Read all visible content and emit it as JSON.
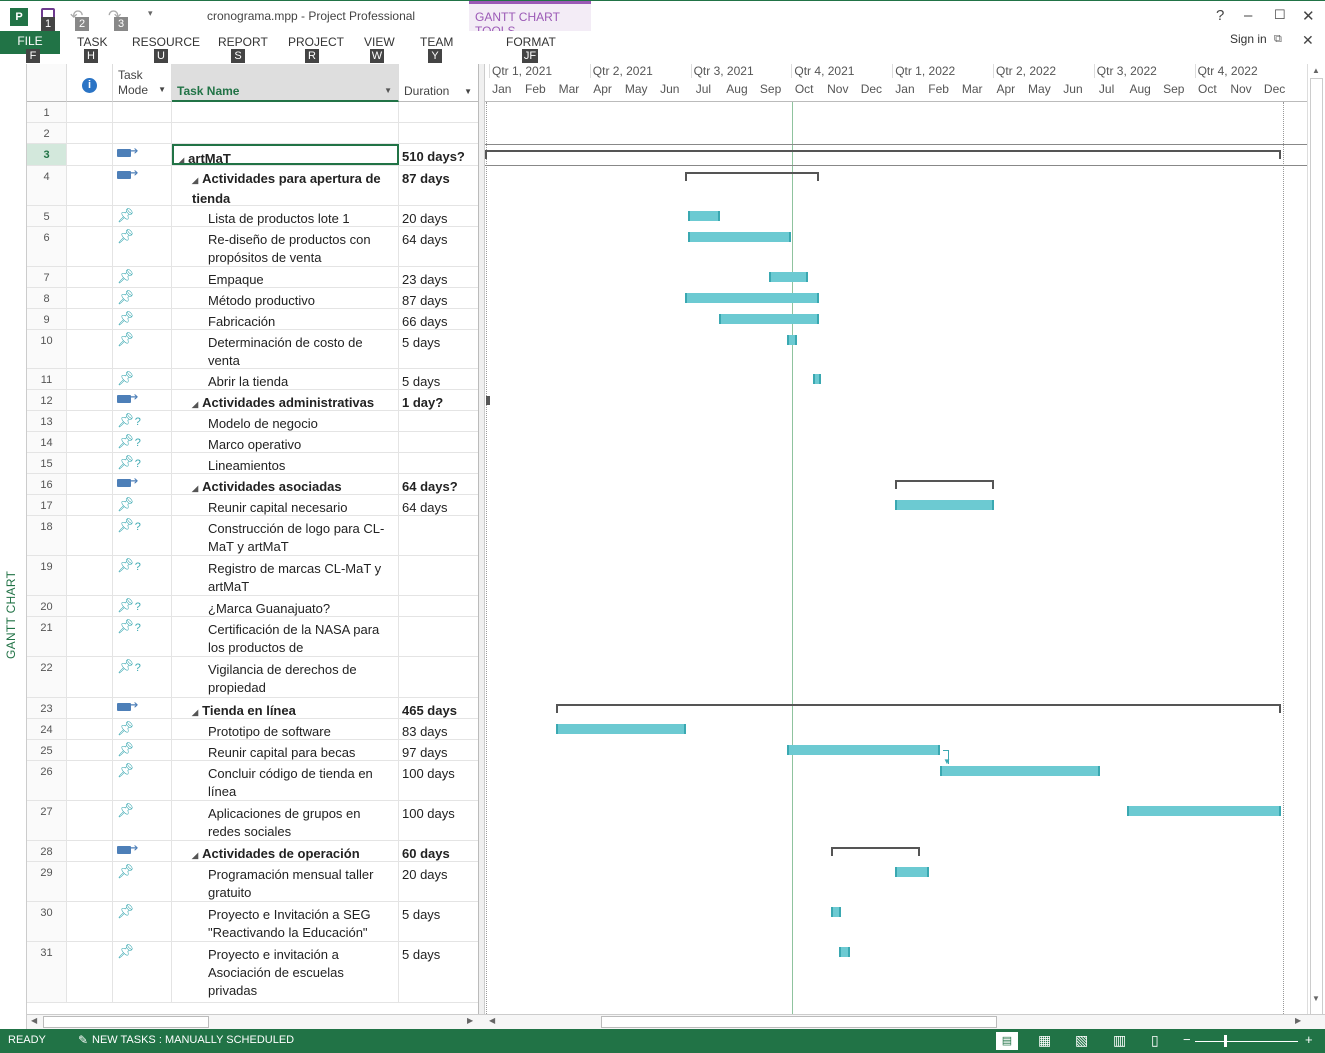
{
  "window": {
    "title": "cronograma.mpp - Project Professional",
    "context_tab": "GANTT CHART TOOLS",
    "help": "?",
    "signin": "Sign in"
  },
  "qat": {
    "key1": "1",
    "key2": "2",
    "key3": "3"
  },
  "ribbon": {
    "tabs": [
      {
        "label": "FILE",
        "key": "F"
      },
      {
        "label": "TASK",
        "key": "H"
      },
      {
        "label": "RESOURCE",
        "key": "U"
      },
      {
        "label": "REPORT",
        "key": "S"
      },
      {
        "label": "PROJECT",
        "key": "R"
      },
      {
        "label": "VIEW",
        "key": "W"
      },
      {
        "label": "TEAM",
        "key": "Y"
      },
      {
        "label": "FORMAT",
        "key": "JF"
      }
    ]
  },
  "view_label": "GANTT CHART",
  "grid_headers": {
    "mode": "Task Mode",
    "name": "Task Name",
    "duration": "Duration"
  },
  "timescale": {
    "quarters": [
      "Qtr 1, 2021",
      "Qtr 2, 2021",
      "Qtr 3, 2021",
      "Qtr 4, 2021",
      "Qtr 1, 2022",
      "Qtr 2, 2022",
      "Qtr 3, 2022",
      "Qtr 4, 2022"
    ],
    "months": [
      "Jan",
      "Feb",
      "Mar",
      "Apr",
      "May",
      "Jun",
      "Jul",
      "Aug",
      "Sep",
      "Oct",
      "Nov",
      "Dec",
      "Jan",
      "Feb",
      "Mar",
      "Apr",
      "May",
      "Jun",
      "Jul",
      "Aug",
      "Sep",
      "Oct",
      "Nov",
      "Dec"
    ]
  },
  "tasks": [
    {
      "id": "1",
      "name": "",
      "duration": "",
      "mode": "",
      "level": 0,
      "summary": false
    },
    {
      "id": "2",
      "name": "",
      "duration": "",
      "mode": "",
      "level": 0,
      "summary": false
    },
    {
      "id": "3",
      "name": "artMaT",
      "duration": "510 days?",
      "mode": "auto",
      "level": 0,
      "summary": true
    },
    {
      "id": "4",
      "name": "Actividades para apertura de tienda",
      "duration": "87 days",
      "mode": "auto",
      "level": 1,
      "summary": true
    },
    {
      "id": "5",
      "name": "Lista de productos lote 1",
      "duration": "20 days",
      "mode": "manual",
      "level": 2,
      "summary": false
    },
    {
      "id": "6",
      "name": "Re-diseño de productos con propósitos de venta",
      "duration": "64 days",
      "mode": "manual",
      "level": 2,
      "summary": false
    },
    {
      "id": "7",
      "name": "Empaque",
      "duration": "23 days",
      "mode": "manual",
      "level": 2,
      "summary": false
    },
    {
      "id": "8",
      "name": "Método productivo",
      "duration": "87 days",
      "mode": "manual",
      "level": 2,
      "summary": false
    },
    {
      "id": "9",
      "name": "Fabricación",
      "duration": "66 days",
      "mode": "manual",
      "level": 2,
      "summary": false
    },
    {
      "id": "10",
      "name": "Determinación de costo de venta",
      "duration": "5 days",
      "mode": "manual",
      "level": 2,
      "summary": false
    },
    {
      "id": "11",
      "name": "Abrir la tienda",
      "duration": "5 days",
      "mode": "manual",
      "level": 2,
      "summary": false
    },
    {
      "id": "12",
      "name": "Actividades administrativas",
      "duration": "1 day?",
      "mode": "auto",
      "level": 1,
      "summary": true
    },
    {
      "id": "13",
      "name": "Modelo de negocio",
      "duration": "",
      "mode": "manual-q",
      "level": 2,
      "summary": false
    },
    {
      "id": "14",
      "name": "Marco operativo",
      "duration": "",
      "mode": "manual-q",
      "level": 2,
      "summary": false
    },
    {
      "id": "15",
      "name": "Lineamientos",
      "duration": "",
      "mode": "manual-q",
      "level": 2,
      "summary": false
    },
    {
      "id": "16",
      "name": "Actividades asociadas",
      "duration": "64 days?",
      "mode": "auto",
      "level": 1,
      "summary": true
    },
    {
      "id": "17",
      "name": "Reunir capital necesario",
      "duration": "64 days",
      "mode": "manual",
      "level": 2,
      "summary": false
    },
    {
      "id": "18",
      "name": "Construcción de logo para CL-MaT y artMaT",
      "duration": "",
      "mode": "manual-q",
      "level": 2,
      "summary": false
    },
    {
      "id": "19",
      "name": "Registro de marcas CL-MaT y artMaT",
      "duration": "",
      "mode": "manual-q",
      "level": 2,
      "summary": false
    },
    {
      "id": "20",
      "name": "¿Marca Guanajuato?",
      "duration": "",
      "mode": "manual-q",
      "level": 2,
      "summary": false
    },
    {
      "id": "21",
      "name": "Certificación de la NASA para los productos de",
      "duration": "",
      "mode": "manual-q",
      "level": 2,
      "summary": false
    },
    {
      "id": "22",
      "name": "Vigilancia de derechos de propiedad",
      "duration": "",
      "mode": "manual-q",
      "level": 2,
      "summary": false
    },
    {
      "id": "23",
      "name": "Tienda en línea",
      "duration": "465 days",
      "mode": "auto",
      "level": 1,
      "summary": true
    },
    {
      "id": "24",
      "name": "Prototipo de software",
      "duration": "83 days",
      "mode": "manual",
      "level": 2,
      "summary": false
    },
    {
      "id": "25",
      "name": "Reunir capital para becas",
      "duration": "97 days",
      "mode": "manual",
      "level": 2,
      "summary": false
    },
    {
      "id": "26",
      "name": "Concluir código de tienda en línea",
      "duration": "100 days",
      "mode": "manual",
      "level": 2,
      "summary": false
    },
    {
      "id": "27",
      "name": "Aplicaciones de grupos en redes sociales",
      "duration": "100 days",
      "mode": "manual",
      "level": 2,
      "summary": false
    },
    {
      "id": "28",
      "name": "Actividades de operación",
      "duration": "60 days",
      "mode": "auto",
      "level": 1,
      "summary": true
    },
    {
      "id": "29",
      "name": "Programación mensual taller gratuito",
      "duration": "20 days",
      "mode": "manual",
      "level": 2,
      "summary": false
    },
    {
      "id": "30",
      "name": "Proyecto e Invitación a SEG \"Reactivando la Educación\"",
      "duration": "5 days",
      "mode": "manual",
      "level": 2,
      "summary": false
    },
    {
      "id": "31",
      "name": "Proyecto e invitación a Asociación de escuelas privadas",
      "duration": "5 days",
      "mode": "manual",
      "level": 2,
      "summary": false
    }
  ],
  "status": {
    "ready": "READY",
    "new_tasks": "NEW TASKS : MANUALLY SCHEDULED"
  }
}
